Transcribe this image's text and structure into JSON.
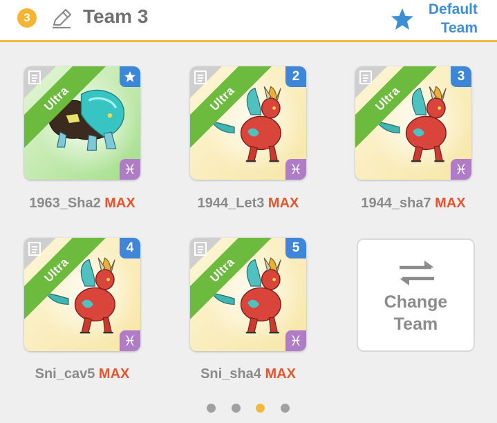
{
  "header": {
    "team_number": "3",
    "team_name": "Team 3",
    "default_line1": "Default",
    "default_line2": "Team"
  },
  "colors": {
    "accent": "#f5b530",
    "link_blue": "#3c8ed6",
    "max_red": "#e5542d",
    "ultra_green": "#6dbb3e",
    "element_purple": "#b07cc8"
  },
  "cards": [
    {
      "rarity": "Ultra",
      "slot_badge": "star",
      "label": "1963_Sha2",
      "level": "MAX",
      "element_icon": "pisces-icon",
      "background": "green"
    },
    {
      "rarity": "Ultra",
      "slot_badge": "2",
      "label": "1944_Let3",
      "level": "MAX",
      "element_icon": "pisces-icon",
      "background": "yellow"
    },
    {
      "rarity": "Ultra",
      "slot_badge": "3",
      "label": "1944_sha7",
      "level": "MAX",
      "element_icon": "pisces-icon",
      "background": "yellow"
    },
    {
      "rarity": "Ultra",
      "slot_badge": "4",
      "label": "Sni_cav5",
      "level": "MAX",
      "element_icon": "pisces-icon",
      "background": "yellow"
    },
    {
      "rarity": "Ultra",
      "slot_badge": "5",
      "label": "Sni_sha4",
      "level": "MAX",
      "element_icon": "pisces-icon",
      "background": "yellow"
    }
  ],
  "change_team": {
    "line1": "Change",
    "line2": "Team",
    "icon": "swap-arrows-icon"
  },
  "pagination": {
    "pages": 4,
    "current": 3
  }
}
